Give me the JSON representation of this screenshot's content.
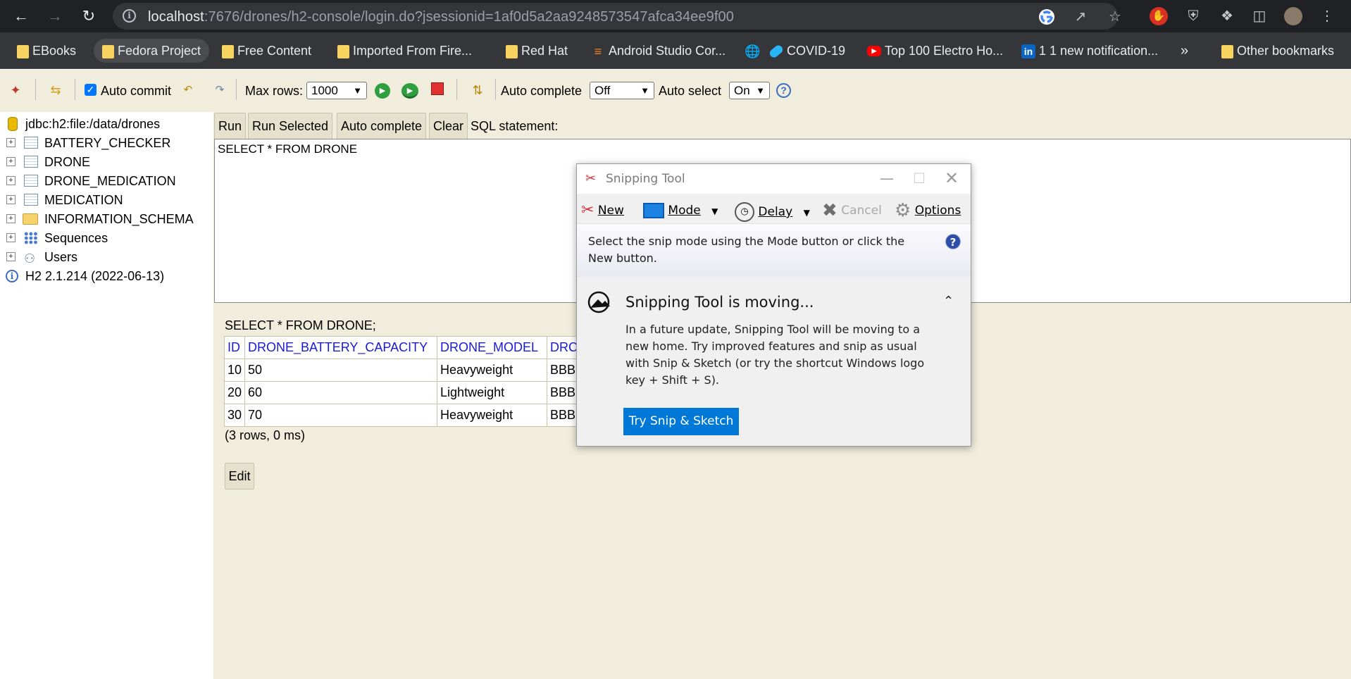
{
  "browser": {
    "url_host": "localhost",
    "url_rest": ":7676/drones/h2-console/login.do?jsessionid=1af0d5a2aa9248573547afca34ee9f00",
    "bookmarks": [
      {
        "label": "EBooks",
        "icon": "folder-icon"
      },
      {
        "label": "Fedora Project",
        "icon": "folder-icon"
      },
      {
        "label": "Free Content",
        "icon": "folder-icon"
      },
      {
        "label": "Imported From Fire...",
        "icon": "folder-icon"
      },
      {
        "label": "Red Hat",
        "icon": "folder-icon"
      },
      {
        "label": "Android Studio Cor...",
        "icon": "stackoverflow-icon"
      },
      {
        "label": "",
        "icon": "globe-icon"
      },
      {
        "label": "COVID-19",
        "icon": "pill-icon"
      },
      {
        "label": "Top 100 Electro Ho...",
        "icon": "youtube-icon"
      },
      {
        "label": "1 1 new notification...",
        "icon": "linkedin-icon"
      }
    ],
    "more_label": "»",
    "other_bookmarks": "Other bookmarks"
  },
  "toolbar": {
    "auto_commit_label": "Auto commit",
    "max_rows_label": "Max rows:",
    "max_rows_value": "1000",
    "auto_complete_label": "Auto complete",
    "auto_complete_value": "Off",
    "auto_select_label": "Auto select",
    "auto_select_value": "On",
    "help_label": "?"
  },
  "tree": {
    "connection": "jdbc:h2:file:/data/drones",
    "tables": [
      "BATTERY_CHECKER",
      "DRONE",
      "DRONE_MEDICATION",
      "MEDICATION"
    ],
    "schema": "INFORMATION_SCHEMA",
    "sequences": "Sequences",
    "users": "Users",
    "version": "H2 2.1.214 (2022-06-13)"
  },
  "editor": {
    "run": "Run",
    "run_selected": "Run Selected",
    "auto_complete": "Auto complete",
    "clear": "Clear",
    "sql_label": "SQL statement:",
    "sql_text": "SELECT * FROM DRONE"
  },
  "result": {
    "query": "SELECT * FROM DRONE;",
    "columns": [
      "ID",
      "DRONE_BATTERY_CAPACITY",
      "DRONE_MODEL",
      "DRC"
    ],
    "rows": [
      [
        "10",
        "50",
        "Heavyweight",
        "BBB"
      ],
      [
        "20",
        "60",
        "Lightweight",
        "BBB"
      ],
      [
        "30",
        "70",
        "Heavyweight",
        "BBB"
      ]
    ],
    "summary": "(3 rows, 0 ms)",
    "edit": "Edit"
  },
  "snipping_tool": {
    "title": "Snipping Tool",
    "new": "New",
    "mode": "Mode",
    "delay": "Delay",
    "cancel": "Cancel",
    "options": "Options",
    "description": "Select the snip mode using the Mode button or click the New button.",
    "news_heading": "Snipping Tool is moving...",
    "news_body": "In a future update, Snipping Tool will be moving to a new home. Try improved features and snip as usual with Snip & Sketch (or try the shortcut Windows logo key + Shift + S).",
    "try_button": "Try Snip & Sketch"
  },
  "colors": {
    "chrome_dark": "#202124",
    "h2_background": "#f0eddc",
    "link_blue": "#1a1ad6",
    "win_accent": "#0078d7"
  }
}
